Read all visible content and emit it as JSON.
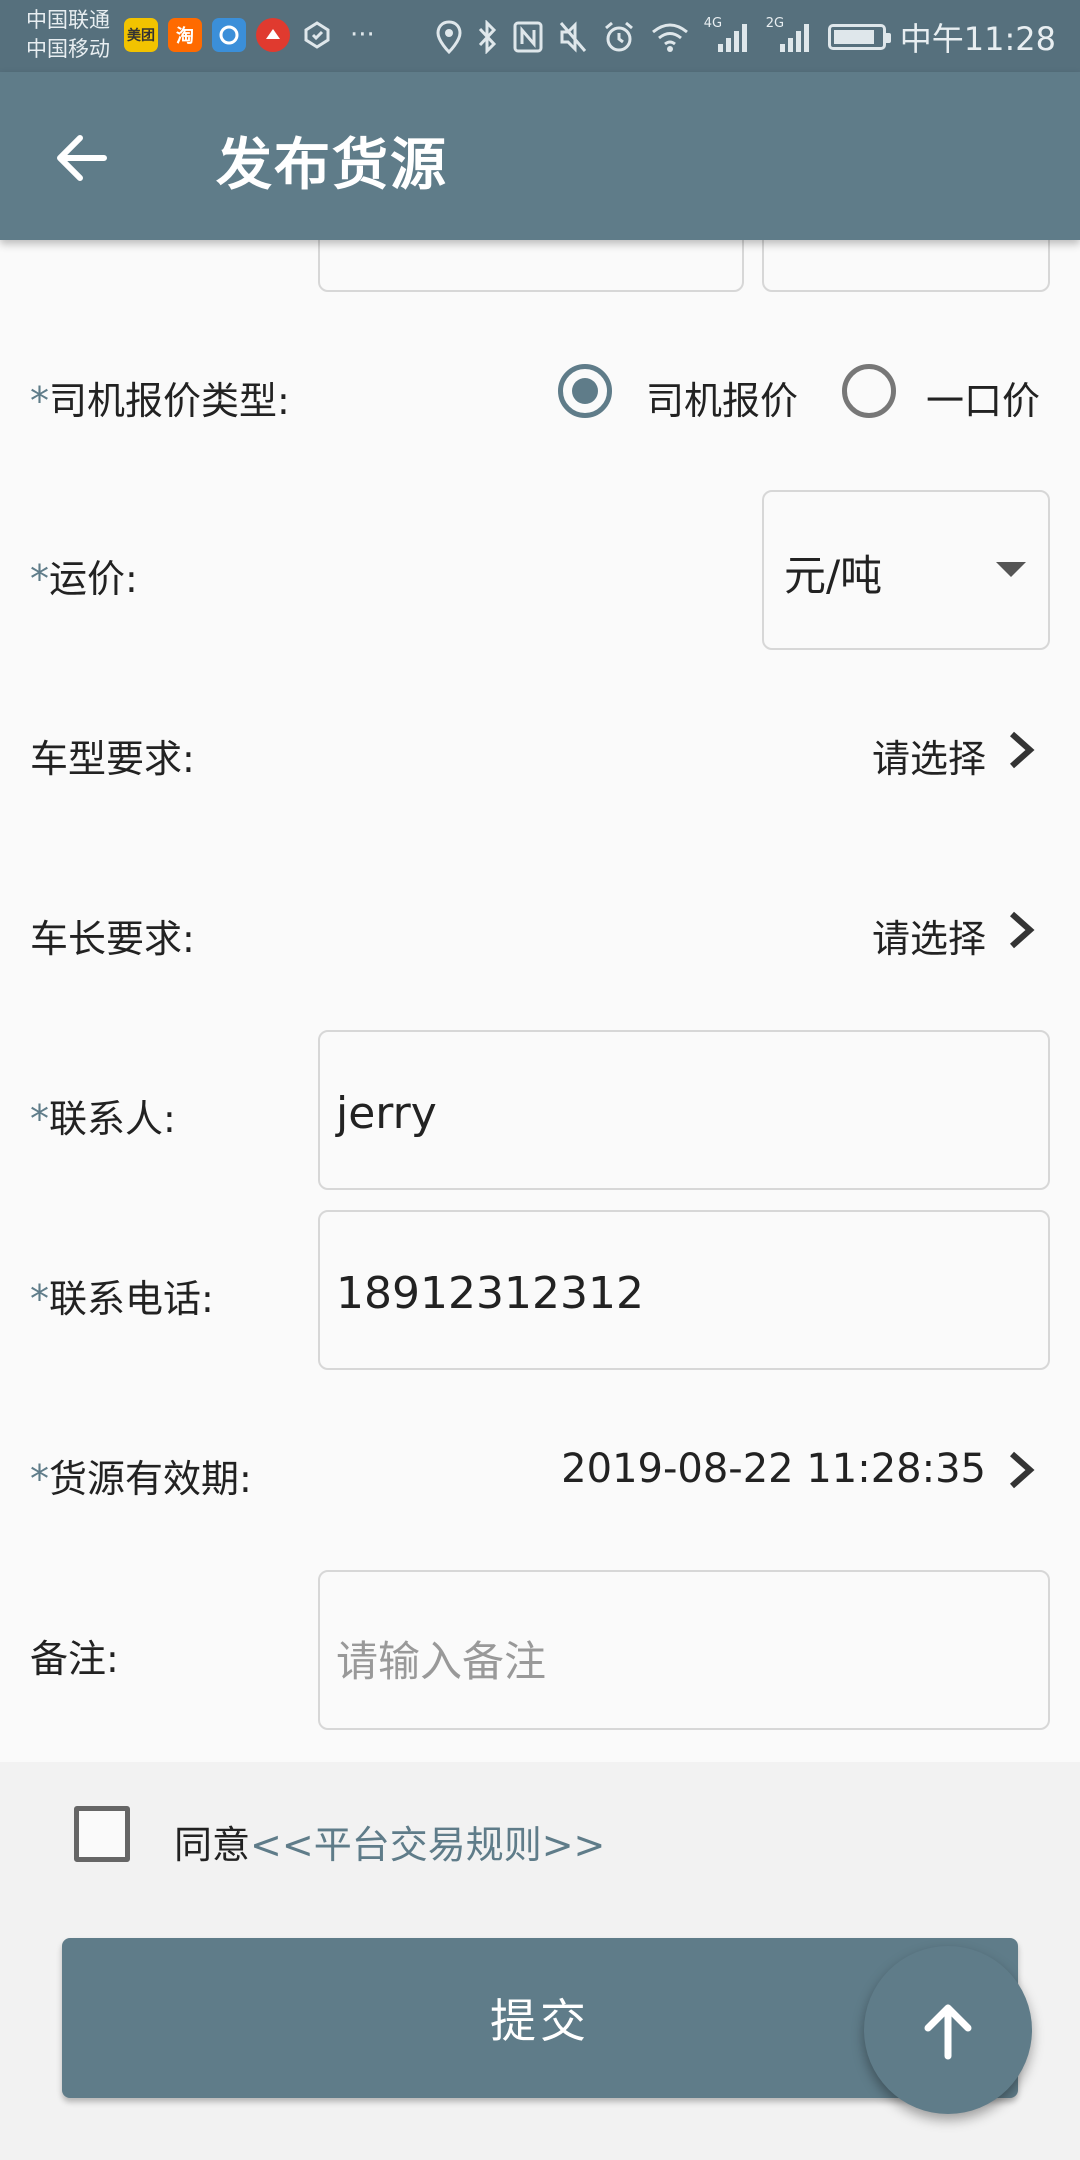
{
  "status_bar": {
    "carrier_1": "中国联通",
    "carrier_2": "中国移动",
    "time": "中午11:28",
    "network_1": "4G",
    "network_2": "2G",
    "app_icons": [
      "meituan-icon",
      "taobao-icon",
      "browser-icon",
      "fox-icon",
      "shield-icon"
    ],
    "app_icon_1_text": "美团",
    "app_icon_2_text": "淘",
    "overflow": "···"
  },
  "header": {
    "title": "发布货源"
  },
  "form": {
    "required_mark": "*",
    "quote_type": {
      "label": "司机报价类型:",
      "options": [
        "司机报价",
        "一口价"
      ],
      "selected": "司机报价"
    },
    "freight": {
      "label": "运价:",
      "unit": "元/吨"
    },
    "vehicle_type": {
      "label": "车型要求:",
      "value": "请选择"
    },
    "vehicle_length": {
      "label": "车长要求:",
      "value": "请选择"
    },
    "contact": {
      "label": "联系人:",
      "value": "jerry"
    },
    "phone": {
      "label": "联系电话:",
      "value": "18912312312"
    },
    "validity": {
      "label": "货源有效期:",
      "value": "2019-08-22 11:28:35"
    },
    "remark": {
      "label": "备注:",
      "placeholder": "请输入备注"
    }
  },
  "agreement": {
    "prefix": "同意",
    "link": "<<平台交易规则>>"
  },
  "submit_label": "提交",
  "colors": {
    "primary": "#5f7c89",
    "status_bar": "#56707d",
    "background": "#fafafa"
  }
}
